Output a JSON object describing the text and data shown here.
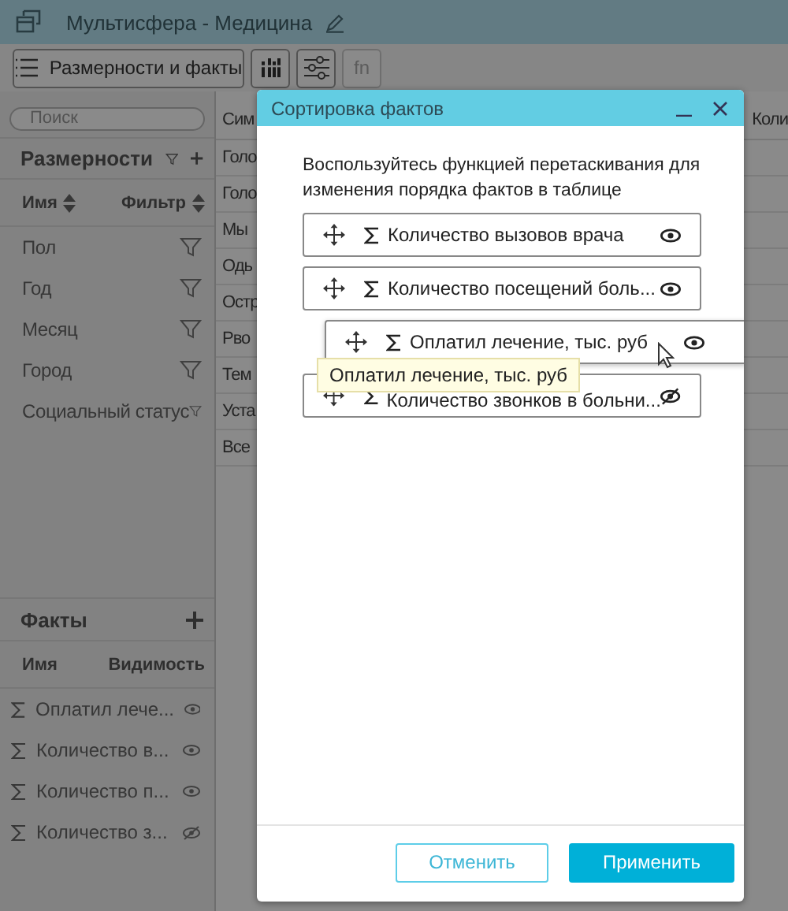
{
  "app": {
    "title": "Мультисфера - Медицина"
  },
  "toolbar": {
    "dimensions_button": "Размерности и факты",
    "fn_button": {
      "label": "fn",
      "disabled": true
    }
  },
  "sidebar": {
    "search": {
      "placeholder": "Поиск"
    },
    "dimensions": {
      "title": "Размерности",
      "columns": [
        "Имя",
        "Фильтр"
      ],
      "items": [
        "Пол",
        "Год",
        "Месяц",
        "Город",
        "Социальный статус"
      ]
    },
    "facts": {
      "title": "Факты",
      "columns": [
        "Имя",
        "Видимость"
      ],
      "items": [
        {
          "label": "Оплатил лече...",
          "visible": true
        },
        {
          "label": "Количество в...",
          "visible": true
        },
        {
          "label": "Количество п...",
          "visible": true
        },
        {
          "label": "Количество з...",
          "visible": false
        }
      ]
    }
  },
  "table": {
    "columns": [
      "Сим",
      "Коли"
    ],
    "rows": [
      "Голо",
      "Голо",
      "Мы",
      "Одь",
      "Остр",
      "Рво",
      "Тем",
      "Уста",
      "Все"
    ]
  },
  "dialog": {
    "title": "Сортировка фактов",
    "instruction": "Воспользуйтесь функцией перетаскивания для изменения порядка фактов в таблице",
    "items": [
      {
        "label": "Количество вызовов врача",
        "visible": true,
        "dragging": false
      },
      {
        "label": "Количество посещений боль...",
        "visible": true,
        "dragging": false
      },
      {
        "label": "Оплатил лечение, тыс. руб",
        "visible": true,
        "dragging": true
      },
      {
        "label": "Количество звонков в больни...",
        "visible": false,
        "dragging": false
      }
    ],
    "tooltip": "Оплатил лечение, тыс. руб",
    "buttons": {
      "cancel": "Отменить",
      "apply": "Применить"
    }
  }
}
